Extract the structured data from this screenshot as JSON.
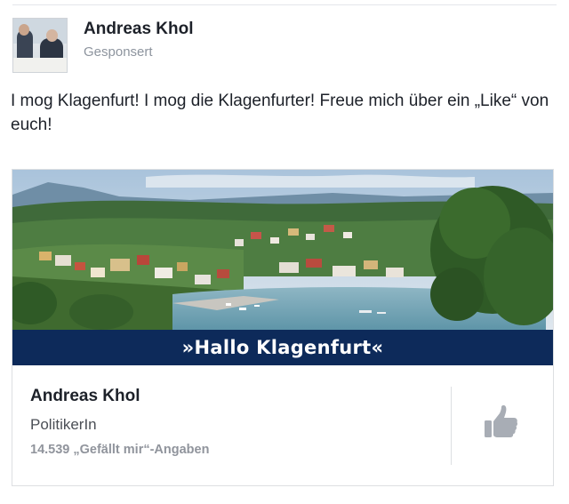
{
  "post": {
    "author": "Andreas Khol",
    "sponsored_label": "Gesponsert",
    "text": "I mog Klagenfurt! I mog die Klagenfurter! Freue mich über ein „Like“ von euch!"
  },
  "ad": {
    "banner_text": "»Hallo Klagenfurt«",
    "page_name": "Andreas Khol",
    "page_category": "PolitikerIn",
    "likes_text": "14.539 „Gefällt mir“-Angaben",
    "like_icon": "thumbs-up-icon"
  },
  "colors": {
    "banner_bg": "#0d2a5a",
    "like_icon": "#a8adb5"
  }
}
